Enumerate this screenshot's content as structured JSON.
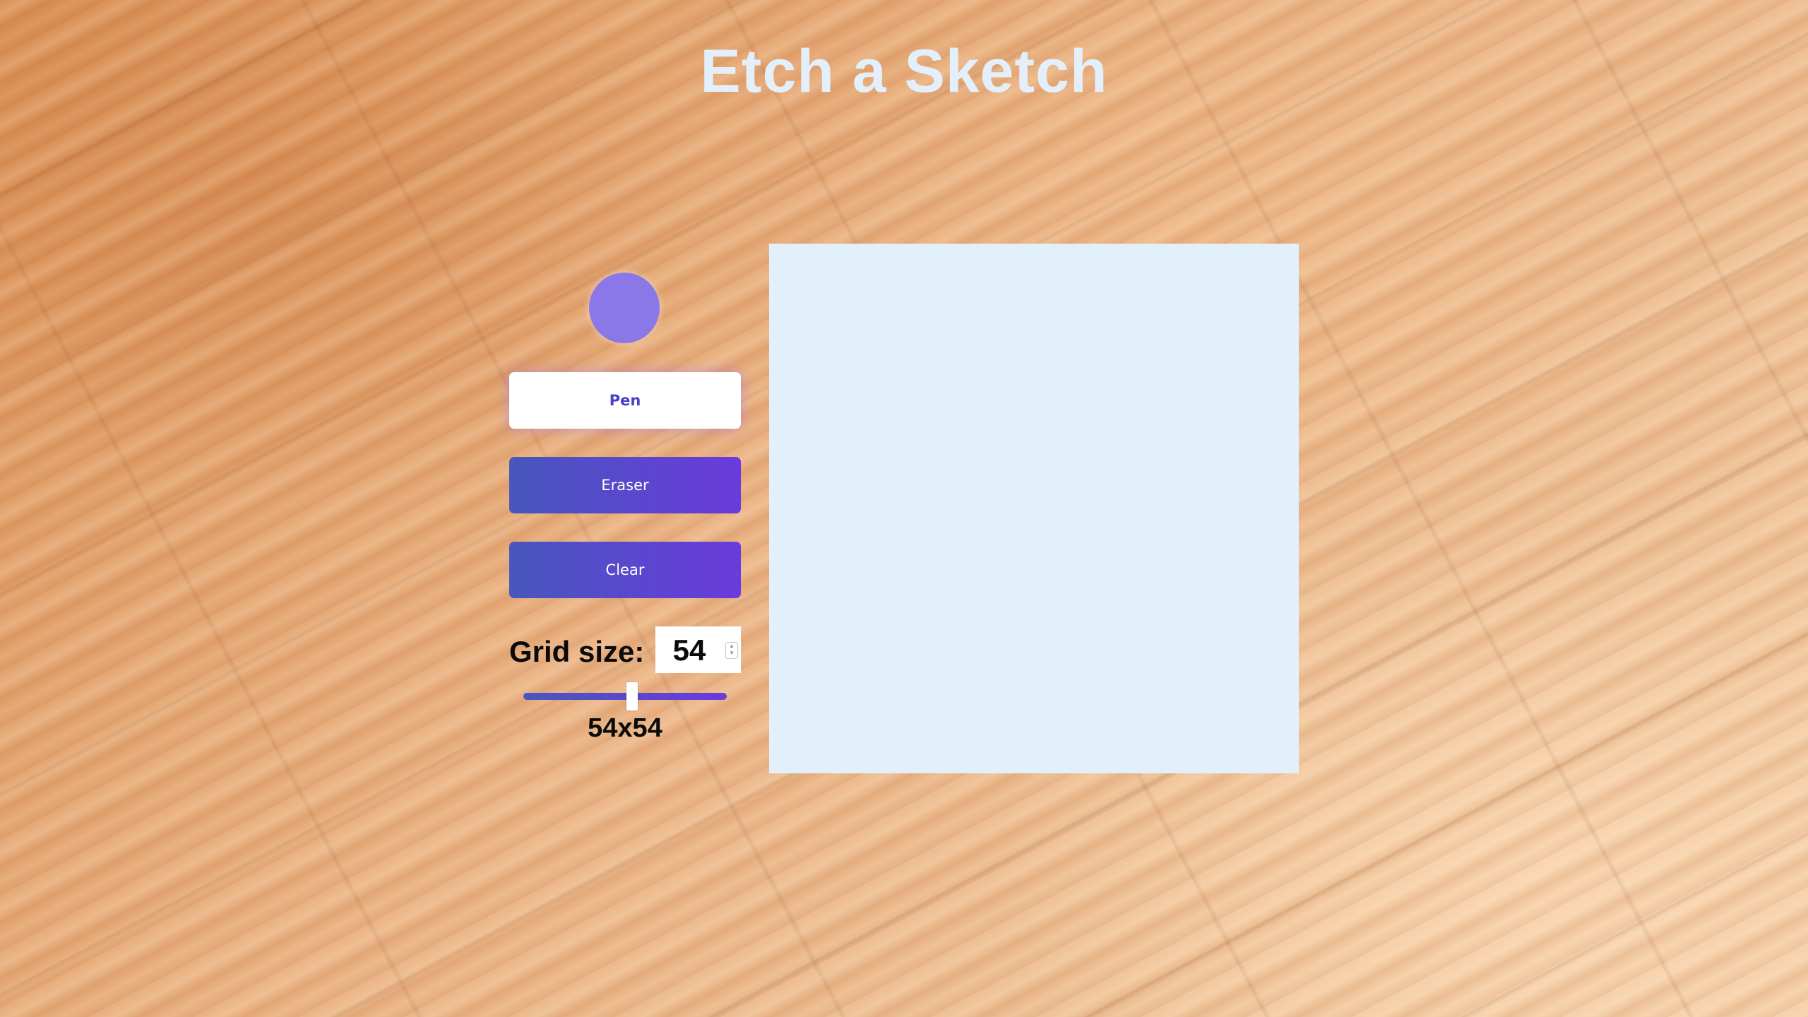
{
  "app": {
    "title": "Etch a Sketch"
  },
  "controls": {
    "pen_color": "#8a78e8",
    "pen_label": "Pen",
    "eraser_label": "Eraser",
    "clear_label": "Clear",
    "active_tool": "Pen"
  },
  "grid": {
    "label": "Grid size:",
    "value": "54",
    "slider_min": 1,
    "slider_max": 100,
    "slider_value": 54,
    "dimensions_text": "54x54"
  },
  "colors": {
    "title": "#e3effa",
    "canvas_background": "#e2f0fb",
    "accent_start": "#4856bd",
    "accent_end": "#6a3bdc"
  }
}
